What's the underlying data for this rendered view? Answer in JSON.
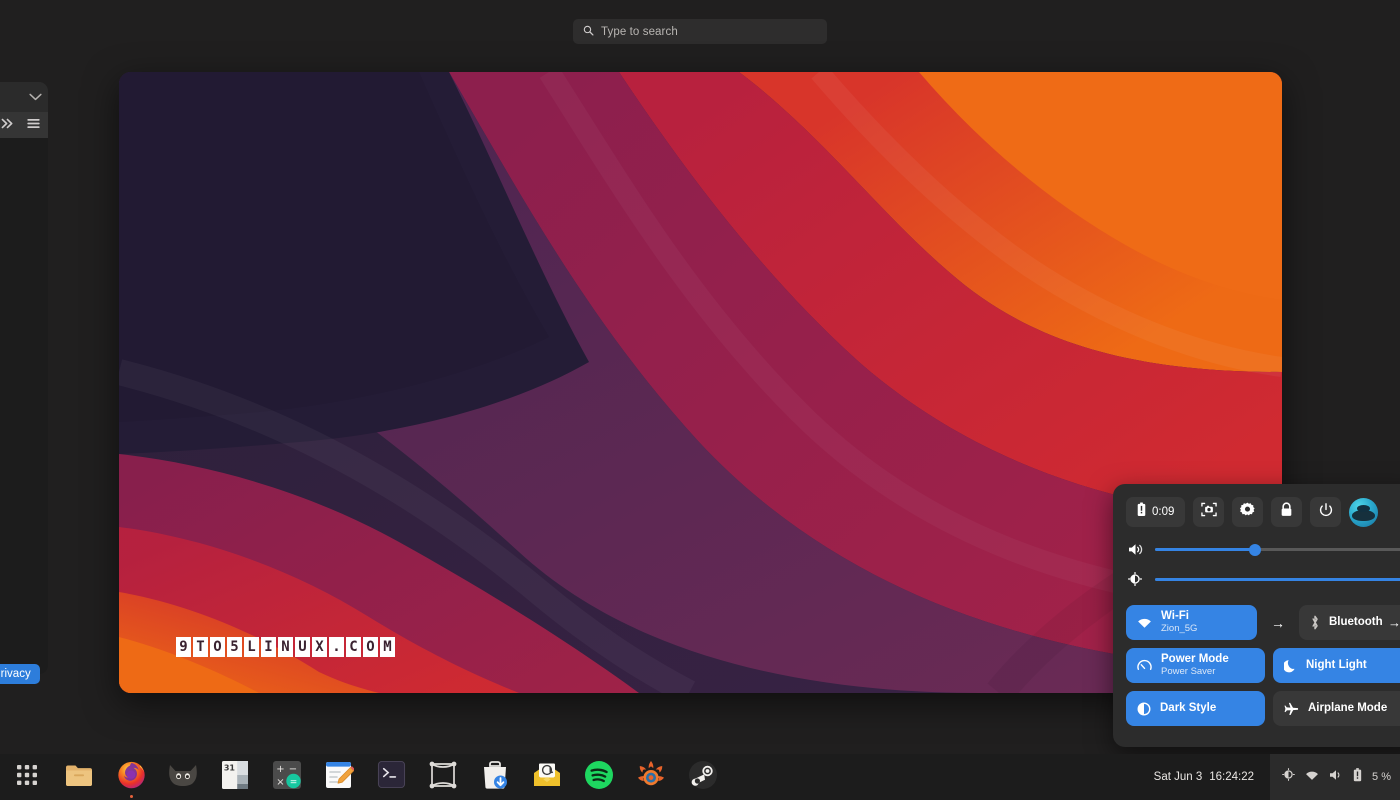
{
  "search": {
    "placeholder": "Type to search",
    "icon": "search-icon"
  },
  "left_window": {
    "chevron_icon": "chevron-down-icon",
    "expand_icon": "double-chevron-right-icon",
    "menu_icon": "hamburger-menu-icon",
    "privacy_label": "Privacy"
  },
  "wallpaper": {
    "watermark": "9TO5LINUX.COM",
    "colors": {
      "deep_purple": "#2b1f3d",
      "dark_indigo": "#241c36",
      "plum": "#5b2650",
      "magenta": "#8e1f4e",
      "crimson": "#c0213c",
      "red": "#d8332a",
      "orange": "#e8561b",
      "bright_orange": "#ef6b16"
    }
  },
  "quick_settings": {
    "battery": {
      "label": "0:09",
      "icon": "battery-icon"
    },
    "buttons": [
      {
        "name": "screenshot-button",
        "icon": "screenshot-icon"
      },
      {
        "name": "settings-button",
        "icon": "gear-icon"
      },
      {
        "name": "lock-button",
        "icon": "lock-icon"
      },
      {
        "name": "power-button",
        "icon": "power-icon"
      }
    ],
    "avatar": "user-avatar",
    "sliders": [
      {
        "name": "volume-slider",
        "icon": "volume-icon",
        "value": 40
      },
      {
        "name": "brightness-slider",
        "icon": "brightness-icon",
        "value": 100
      }
    ],
    "tiles": [
      {
        "name": "wifi",
        "title": "Wi-Fi",
        "subtitle": "Zion_5G",
        "icon": "wifi-icon",
        "active": true,
        "has_arrow": true
      },
      {
        "name": "bluetooth",
        "title": "Bluetooth",
        "subtitle": "",
        "icon": "bluetooth-icon",
        "active": false,
        "has_arrow": true
      },
      {
        "name": "power-mode",
        "title": "Power Mode",
        "subtitle": "Power Saver",
        "icon": "speedometer-icon",
        "active": true,
        "has_arrow": false
      },
      {
        "name": "night-light",
        "title": "Night Light",
        "subtitle": "",
        "icon": "moon-icon",
        "active": true,
        "has_arrow": false
      },
      {
        "name": "dark-style",
        "title": "Dark Style",
        "subtitle": "",
        "icon": "contrast-icon",
        "active": true,
        "has_arrow": false
      },
      {
        "name": "airplane-mode",
        "title": "Airplane Mode",
        "subtitle": "",
        "icon": "airplane-icon",
        "active": false,
        "has_arrow": false
      }
    ],
    "accent_color": "#3584e4",
    "inactive_color": "#383838"
  },
  "dock": {
    "items": [
      {
        "name": "app-grid-icon",
        "label": "Show Applications",
        "running": false
      },
      {
        "name": "files-icon",
        "label": "Files",
        "running": false
      },
      {
        "name": "firefox-icon",
        "label": "Firefox",
        "running": true
      },
      {
        "name": "thunderbird-cat-icon",
        "label": "Mail Cat",
        "running": false
      },
      {
        "name": "calendar-icon",
        "label": "Calendar",
        "running": false
      },
      {
        "name": "calculator-icon",
        "label": "Calculator",
        "running": false
      },
      {
        "name": "text-editor-icon",
        "label": "Text Editor",
        "running": false
      },
      {
        "name": "terminal-icon",
        "label": "Terminal",
        "running": false
      },
      {
        "name": "boxes-icon",
        "label": "Boxes",
        "running": false
      },
      {
        "name": "software-icon",
        "label": "Software",
        "running": false
      },
      {
        "name": "mail-icon",
        "label": "Mail",
        "running": false
      },
      {
        "name": "spotify-icon",
        "label": "Spotify",
        "running": false
      },
      {
        "name": "krita-icon",
        "label": "Krita",
        "running": false
      },
      {
        "name": "steam-icon",
        "label": "Steam",
        "running": false
      }
    ],
    "calendar_day": "31"
  },
  "status_bar": {
    "date": "Sat Jun 3",
    "time": "16:24:22",
    "tray_icons": [
      "brightness-icon",
      "wifi-icon",
      "volume-icon",
      "battery-icon"
    ],
    "battery_percent": "5 %"
  }
}
